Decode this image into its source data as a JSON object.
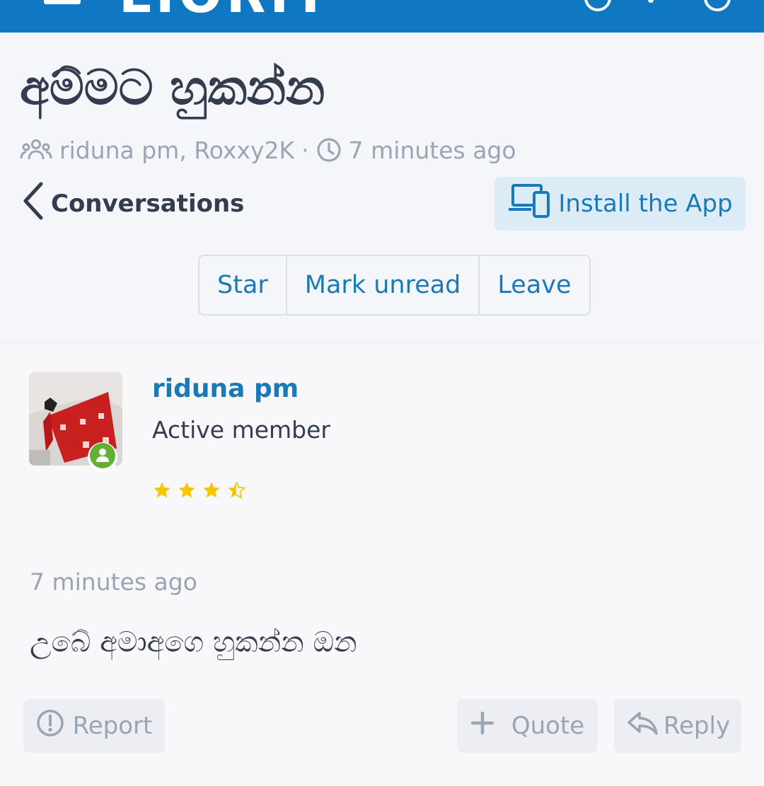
{
  "topbar": {
    "logo_text": "LIORIT",
    "brand_color": "#1078c2"
  },
  "conversation": {
    "title": "අම්මට හුකන්න",
    "participants": "riduna pm, Roxxy2K",
    "separator": "·",
    "time": "7 minutes ago"
  },
  "nav": {
    "back_label": "Conversations",
    "install_label": "Install the App"
  },
  "actions": {
    "star": "Star",
    "mark_unread": "Mark unread",
    "leave": "Leave"
  },
  "message": {
    "username": "riduna pm",
    "user_title": "Active member",
    "rating": 3.5,
    "rating_max": 4,
    "timestamp": "7 minutes ago",
    "body": "උබේ අමාඅගෙ හුකන්න ඔන",
    "report": "Report",
    "quote": "Quote",
    "reply": "Reply"
  },
  "colors": {
    "accent": "#1a7ab8",
    "muted": "#9aa5b3",
    "text": "#333d4f",
    "online": "#63b132",
    "star": "#f7c600"
  },
  "icons": [
    "menu-icon",
    "users-icon",
    "clock-icon",
    "chevron-left-icon",
    "devices-icon",
    "online-user-icon",
    "star-icon",
    "report-icon",
    "plus-icon",
    "reply-icon"
  ]
}
